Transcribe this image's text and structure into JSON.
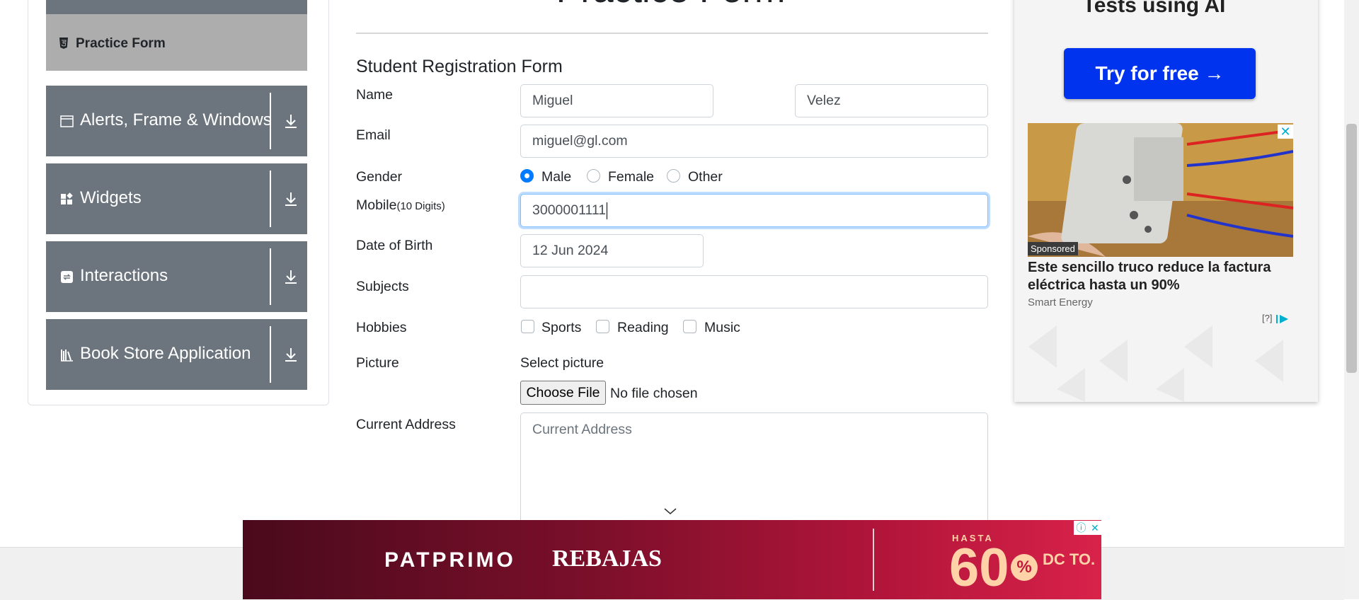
{
  "sidebar": {
    "active_item": "Practice Form",
    "groups": [
      {
        "label": "Alerts, Frame & Windows",
        "icon": "window-icon"
      },
      {
        "label": "Widgets",
        "icon": "widgets-icon"
      },
      {
        "label": "Interactions",
        "icon": "interactions-icon"
      },
      {
        "label": "Book Store Application",
        "icon": "books-icon"
      }
    ]
  },
  "form": {
    "page_title": "Practice Form",
    "title": "Student Registration Form",
    "name": {
      "label": "Name",
      "first": "Miguel",
      "last": "Velez"
    },
    "email": {
      "label": "Email",
      "value": "miguel@gl.com"
    },
    "gender": {
      "label": "Gender",
      "options": [
        "Male",
        "Female",
        "Other"
      ],
      "selected": "Male"
    },
    "mobile": {
      "label": "Mobile",
      "hint": "(10 Digits)",
      "value": "3000001111"
    },
    "dob": {
      "label": "Date of Birth",
      "value": "12 Jun 2024"
    },
    "subjects": {
      "label": "Subjects",
      "value": ""
    },
    "hobbies": {
      "label": "Hobbies",
      "options": [
        "Sports",
        "Reading",
        "Music"
      ]
    },
    "picture": {
      "label": "Picture",
      "select_label": "Select picture",
      "button": "Choose File",
      "status": "No file chosen"
    },
    "address": {
      "label": "Current Address",
      "placeholder": "Current Address"
    }
  },
  "ad_right": {
    "headline": "Tests using AI",
    "button": "Try for free →",
    "sponsored": "Sponsored",
    "text": "Este sencillo truco reduce la factura eléctrica hasta un 90%",
    "source": "Smart Energy",
    "info": "[?]"
  },
  "ad_bottom": {
    "brand": "PATPRIMO",
    "sale": "REBAJAS",
    "hasta": "HASTA",
    "amount": "60",
    "percent": "%",
    "dcto": "DC TO."
  },
  "colors": {
    "sidebar_group": "#6c757d",
    "active_item": "#adadad",
    "primary": "#007bff",
    "ad_button": "#0033ee"
  }
}
